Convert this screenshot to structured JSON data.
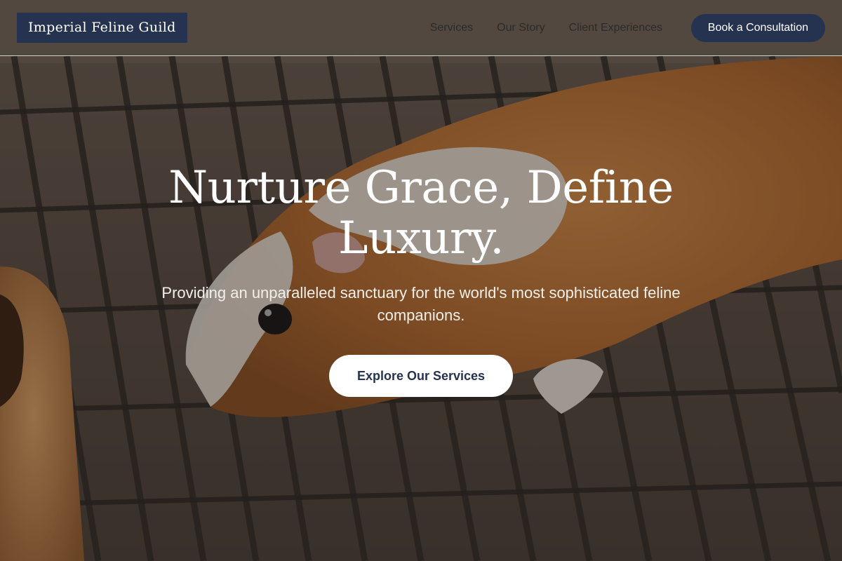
{
  "header": {
    "logo_text": "Imperial Feline Guild",
    "nav": [
      {
        "label": "Services"
      },
      {
        "label": "Our Story"
      },
      {
        "label": "Client Experiences"
      }
    ],
    "cta_label": "Book a Consultation"
  },
  "hero": {
    "background_image": "guinea-pig-on-wire-grate-photo",
    "headline": "Nurture Grace, Define Luxury.",
    "subtitle": "Providing an unparalleled sanctuary for the world's most sophisticated feline companions.",
    "cta_label": "Explore Our Services"
  },
  "colors": {
    "brand_navy": "#263350",
    "white": "#ffffff"
  }
}
